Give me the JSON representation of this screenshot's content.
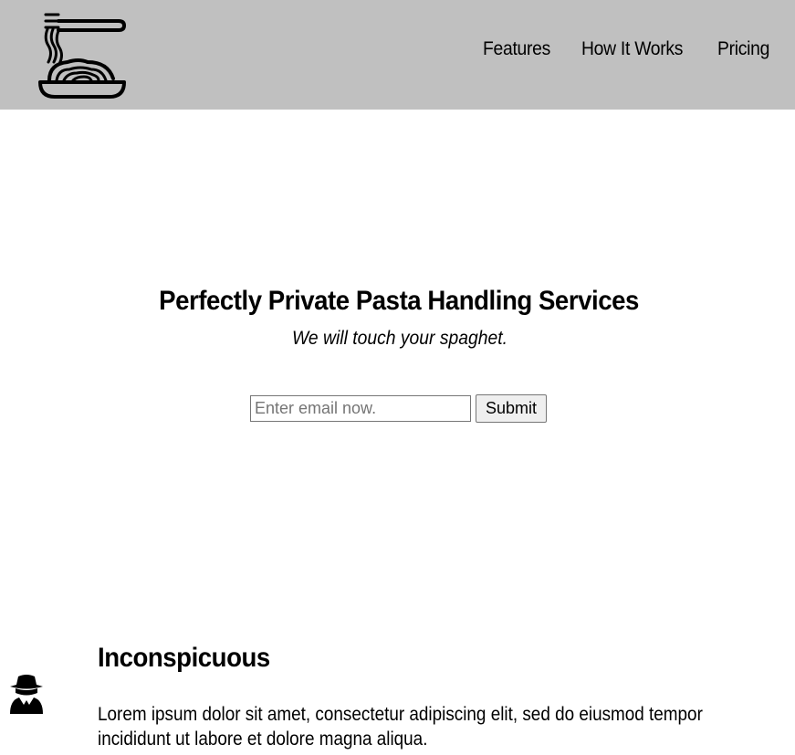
{
  "header": {
    "logo_icon": "spaghetti-plate-icon",
    "background_color": "#c0c0c0",
    "nav": [
      {
        "label": "Features"
      },
      {
        "label": "How It Works"
      },
      {
        "label": "Pricing"
      }
    ]
  },
  "hero": {
    "title": "Perfectly Private Pasta Handling Services",
    "subtitle": "We will touch your spaghet.",
    "form": {
      "email_placeholder": "Enter email now.",
      "email_value": "",
      "submit_label": "Submit"
    }
  },
  "features": [
    {
      "icon": "spy-icon",
      "title": "Inconspicuous",
      "text": "Lorem ipsum dolor sit amet, consectetur adipiscing elit, sed do eiusmod tempor incididunt ut labore et dolore magna aliqua."
    }
  ]
}
